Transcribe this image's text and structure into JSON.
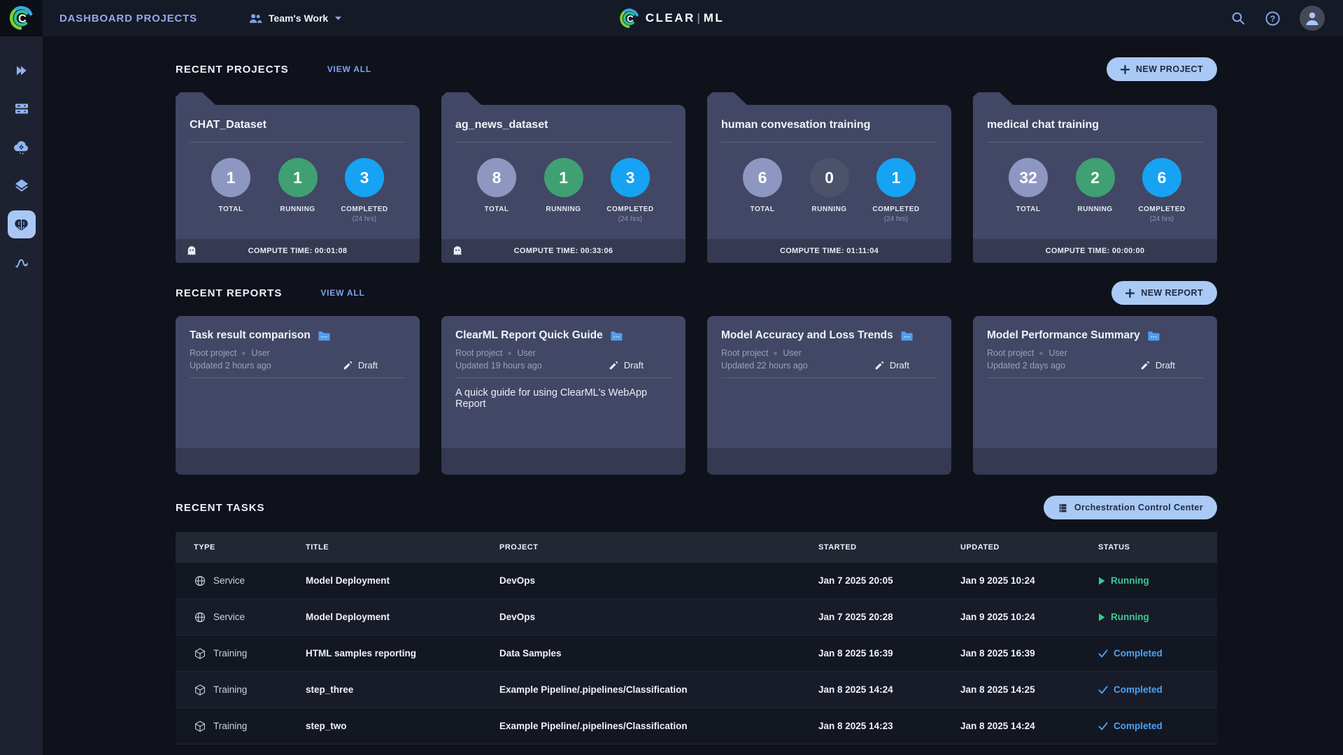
{
  "topbar": {
    "title": "DASHBOARD PROJECTS",
    "workspace": "Team's Work"
  },
  "brand": {
    "letter": "C",
    "left": "CLEAR",
    "right": "ML"
  },
  "sidebar": {
    "items": [
      "projects-icon",
      "queues-icon",
      "applications-cloud-icon",
      "datasets-layers-icon",
      "models-brain-icon",
      "pipelines-icon"
    ],
    "active_item": "models-brain-icon"
  },
  "projects": {
    "heading": "RECENT PROJECTS",
    "view_all": "VIEW ALL",
    "new_button": "NEW PROJECT",
    "stat_labels": {
      "total": "TOTAL",
      "running": "RUNNING",
      "completed": "COMPLETED",
      "window": "(24 hrs)"
    },
    "cards": [
      {
        "title": "CHAT_Dataset",
        "total": "1",
        "running": "1",
        "running_state": "active",
        "completed": "3",
        "compute_time": "COMPUTE TIME: 00:01:08",
        "ghost": true
      },
      {
        "title": "ag_news_dataset",
        "total": "8",
        "running": "1",
        "running_state": "active",
        "completed": "3",
        "compute_time": "COMPUTE TIME: 00:33:06",
        "ghost": true
      },
      {
        "title": "human convesation training",
        "total": "6",
        "running": "0",
        "running_state": "muted",
        "completed": "1",
        "compute_time": "COMPUTE TIME: 01:11:04",
        "ghost": false
      },
      {
        "title": "medical chat training",
        "total": "32",
        "running": "2",
        "running_state": "active",
        "completed": "6",
        "compute_time": "COMPUTE TIME: 00:00:00",
        "ghost": false
      }
    ]
  },
  "reports": {
    "heading": "RECENT REPORTS",
    "view_all": "VIEW ALL",
    "new_button": "NEW REPORT",
    "cards": [
      {
        "title": "Task result comparison",
        "project": "Root project",
        "user": "User",
        "updated": "Updated 2 hours ago",
        "status": "Draft",
        "description": "",
        "has_description": false
      },
      {
        "title": "ClearML Report Quick Guide",
        "project": "Root project",
        "user": "User",
        "updated": "Updated 19 hours ago",
        "status": "Draft",
        "description": "A quick guide for using ClearML's WebApp Report",
        "has_description": true
      },
      {
        "title": "Model Accuracy and Loss Trends",
        "project": "Root project",
        "user": "User",
        "updated": "Updated 22 hours ago",
        "status": "Draft",
        "description": "",
        "has_description": false
      },
      {
        "title": "Model Performance Summary",
        "project": "Root project",
        "user": "User",
        "updated": "Updated 2 days ago",
        "status": "Draft",
        "description": "",
        "has_description": false
      }
    ]
  },
  "tasks": {
    "heading": "RECENT TASKS",
    "orchestration_button": "Orchestration Control Center",
    "columns": [
      "TYPE",
      "TITLE",
      "PROJECT",
      "STARTED",
      "UPDATED",
      "STATUS"
    ],
    "rows": [
      {
        "type_label": "Service",
        "icon_globe": true,
        "icon_cube": false,
        "title": "Model Deployment",
        "project": "DevOps",
        "started": "Jan 7 2025 20:05",
        "updated": "Jan 9 2025 10:24",
        "status": "Running",
        "status_kind": "running"
      },
      {
        "type_label": "Service",
        "icon_globe": true,
        "icon_cube": false,
        "title": "Model Deployment",
        "project": "DevOps",
        "started": "Jan 7 2025 20:28",
        "updated": "Jan 9 2025 10:24",
        "status": "Running",
        "status_kind": "running"
      },
      {
        "type_label": "Training",
        "icon_globe": false,
        "icon_cube": true,
        "title": "HTML samples reporting",
        "project": "Data Samples",
        "started": "Jan 8 2025 16:39",
        "updated": "Jan 8 2025 16:39",
        "status": "Completed",
        "status_kind": "completed"
      },
      {
        "type_label": "Training",
        "icon_globe": false,
        "icon_cube": true,
        "title": "step_three",
        "project": "Example Pipeline/.pipelines/Classification",
        "started": "Jan 8 2025 14:24",
        "updated": "Jan 8 2025 14:25",
        "status": "Completed",
        "status_kind": "completed"
      },
      {
        "type_label": "Training",
        "icon_globe": false,
        "icon_cube": true,
        "title": "step_two",
        "project": "Example Pipeline/.pipelines/Classification",
        "started": "Jan 8 2025 14:23",
        "updated": "Jan 8 2025 14:24",
        "status": "Completed",
        "status_kind": "completed"
      }
    ]
  },
  "colors": {
    "accent_button": "#aac9f5",
    "running_status": "#38cb92",
    "completed_status": "#4ca3f3",
    "total_circle": "#8e97c1",
    "running_circle": "#3fa074",
    "running_circle_muted": "#4c5269",
    "completed_circle": "#16a3f3",
    "card_body": "#424765",
    "card_footer": "#353a52",
    "page_bg": "#0f121b"
  }
}
